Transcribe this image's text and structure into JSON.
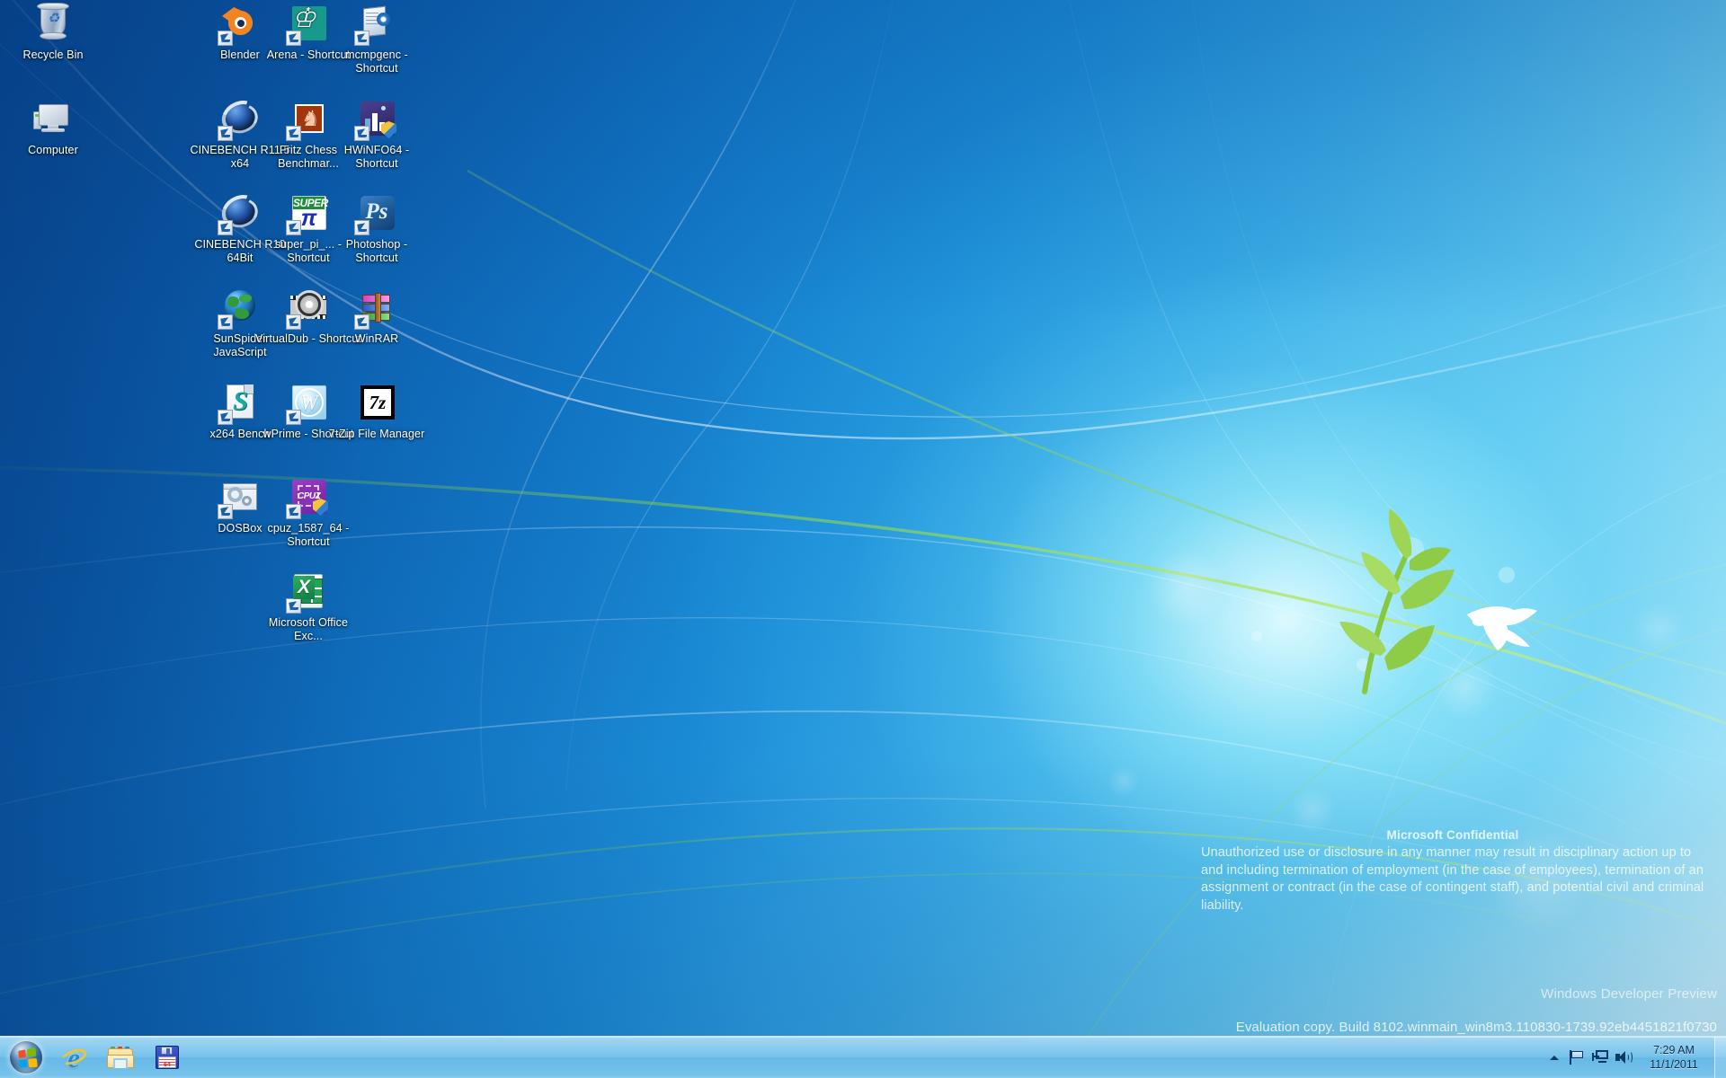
{
  "desktop": {
    "wallpaper_name": "windows-developer-preview-betta-wallpaper",
    "colors": {
      "wallpaper_deep_blue": "#0a4f9e",
      "wallpaper_light_cyan": "#cdf2fb",
      "accent_green": "#8fd14f",
      "taskbar_blue": "#64b6e4",
      "icon_label": "#ffffff"
    },
    "icons": [
      {
        "name": "recycle-bin",
        "label": "Recycle Bin",
        "icon": "recycle-bin-icon",
        "shortcut": false,
        "col": 0,
        "row": 0
      },
      {
        "name": "computer",
        "label": "Computer",
        "icon": "computer-icon",
        "shortcut": false,
        "col": 0,
        "row": 1
      },
      {
        "name": "blender",
        "label": "Blender",
        "icon": "blender-icon",
        "shortcut": true,
        "col": 2,
        "row": 0
      },
      {
        "name": "arena",
        "label": "Arena - Shortcut",
        "icon": "chess-king-icon",
        "shortcut": true,
        "col": 3,
        "row": 0
      },
      {
        "name": "mcmpgenc",
        "label": "mcmpgenc - Shortcut",
        "icon": "software-box-icon",
        "shortcut": true,
        "col": 4,
        "row": 0
      },
      {
        "name": "cinebench-r115-x64",
        "label": "CINEBENCH R11.5 x64",
        "icon": "cinebench-icon",
        "shortcut": true,
        "col": 2,
        "row": 1
      },
      {
        "name": "fritz-chess",
        "label": "Fritz Chess Benchmar...",
        "icon": "chess-knight-icon",
        "shortcut": true,
        "col": 3,
        "row": 1
      },
      {
        "name": "hwinfo64",
        "label": "HWiNFO64 - Shortcut",
        "icon": "hwinfo-icon",
        "shortcut": true,
        "col": 4,
        "row": 1
      },
      {
        "name": "cinebench-r10-64bit",
        "label": "CINEBENCH R10 64Bit",
        "icon": "cinebench-icon",
        "shortcut": true,
        "col": 2,
        "row": 2
      },
      {
        "name": "super-pi",
        "label": "super_pi_... - Shortcut",
        "icon": "super-pi-icon",
        "shortcut": true,
        "col": 3,
        "row": 2
      },
      {
        "name": "photoshop",
        "label": "Photoshop - Shortcut",
        "icon": "photoshop-icon",
        "shortcut": true,
        "col": 4,
        "row": 2
      },
      {
        "name": "sunspider",
        "label": "SunSpider JavaScript",
        "icon": "globe-icon",
        "shortcut": true,
        "col": 2,
        "row": 3
      },
      {
        "name": "virtualdub",
        "label": "VirtualDub - Shortcut",
        "icon": "film-gear-icon",
        "shortcut": true,
        "col": 3,
        "row": 3
      },
      {
        "name": "winrar",
        "label": "WinRAR",
        "icon": "winrar-books-icon",
        "shortcut": true,
        "col": 4,
        "row": 3
      },
      {
        "name": "x264-bench",
        "label": "x264 Bench",
        "icon": "script-document-icon",
        "shortcut": true,
        "col": 2,
        "row": 4
      },
      {
        "name": "wprime",
        "label": "wPrime - Shortcut",
        "icon": "wprime-icon",
        "shortcut": true,
        "col": 3,
        "row": 4
      },
      {
        "name": "7zip-file-manager",
        "label": "7-Zip File Manager",
        "icon": "sevenzip-icon",
        "shortcut": false,
        "col": 4,
        "row": 4
      },
      {
        "name": "dosbox",
        "label": "DOSBox",
        "icon": "dosbox-icon",
        "shortcut": true,
        "col": 2,
        "row": 5
      },
      {
        "name": "cpuz",
        "label": "cpuz_1587_64 - Shortcut",
        "icon": "cpuz-icon",
        "shortcut": true,
        "col": 3,
        "row": 5
      },
      {
        "name": "ms-office-excel",
        "label": "Microsoft Office Exc...",
        "icon": "excel-icon",
        "shortcut": true,
        "col": 3,
        "row": 6
      }
    ]
  },
  "watermark": {
    "title": "Microsoft Confidential",
    "body": "Unauthorized use or disclosure in any manner may result in disciplinary action up to and including termination of employment (in the case of employees), termination of an assignment or contract (in the case of contingent staff), and potential civil and criminal liability."
  },
  "build_info": {
    "edition": "Windows Developer Preview",
    "build": "Evaluation copy. Build 8102.winmain_win8m3.110830-1739.92eb4451821f0730"
  },
  "taskbar": {
    "start_label": "Start",
    "buttons": [
      {
        "name": "internet-explorer",
        "label": "Internet Explorer",
        "icon": "internet-explorer-icon"
      },
      {
        "name": "windows-explorer",
        "label": "Windows Explorer",
        "icon": "folder-icon"
      },
      {
        "name": "disk-benchmark",
        "label": "CrystalDiskMark",
        "icon": "floppy-disk-icon"
      }
    ],
    "tray": {
      "chevron_label": "Show hidden icons",
      "icons": [
        {
          "name": "action-center",
          "label": "Action Center",
          "icon": "flag-icon"
        },
        {
          "name": "network",
          "label": "Network",
          "icon": "network-icon"
        },
        {
          "name": "volume",
          "label": "Volume",
          "icon": "speaker-icon"
        }
      ],
      "clock": {
        "time": "7:29 AM",
        "date": "11/1/2011"
      },
      "show_desktop_label": "Show desktop"
    }
  }
}
